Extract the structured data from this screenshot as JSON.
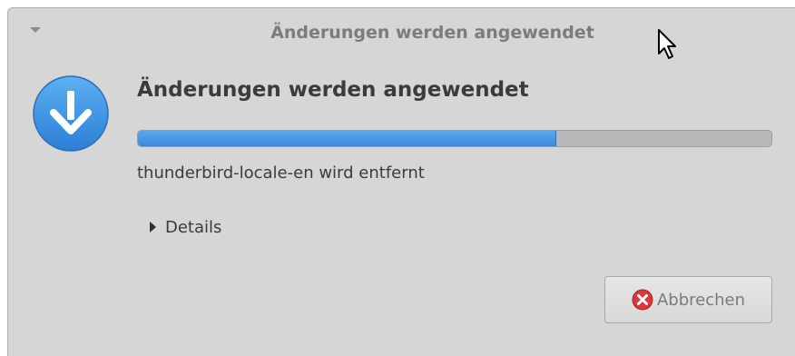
{
  "window": {
    "title": "Änderungen werden angewendet"
  },
  "main": {
    "heading": "Änderungen werden angewendet",
    "progress": 0.66,
    "status": "thunderbird-locale-en wird entfernt",
    "details_label": "Details",
    "icon": "download-arrow-icon"
  },
  "buttons": {
    "cancel_label": "Abbrechen",
    "cancel_icon": "cancel-icon"
  },
  "colors": {
    "accent": "#3b89d8",
    "window_bg": "#d6d6d6",
    "cancel_red": "#d8383a"
  }
}
